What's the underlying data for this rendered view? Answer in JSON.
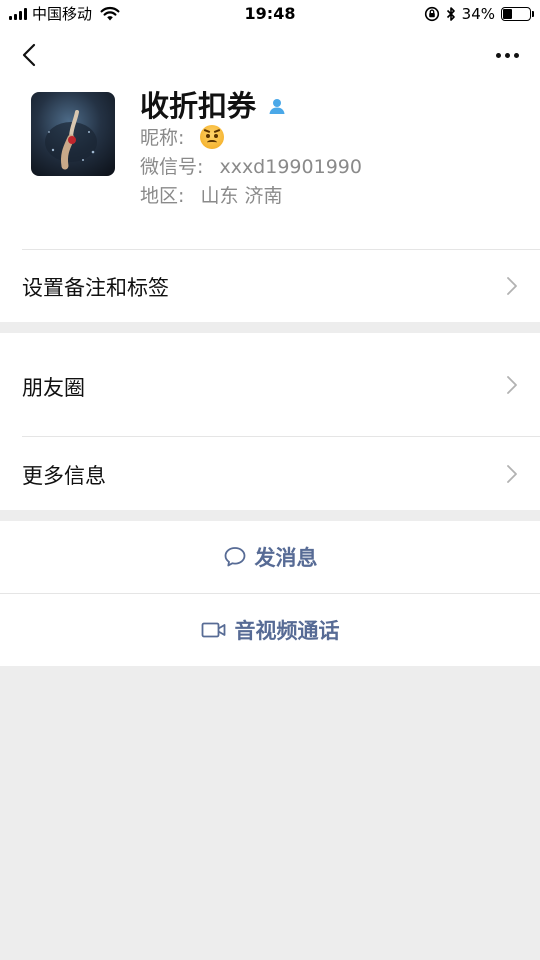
{
  "status_bar": {
    "carrier": "中国移动",
    "time": "19:48",
    "battery_percent": "34%",
    "battery_level": 0.34
  },
  "profile": {
    "name": "收折扣券",
    "nickname_label": "昵称:",
    "wechat_id_label": "微信号:",
    "wechat_id": "xxxd19901990",
    "region_label": "地区:",
    "region": "山东 济南"
  },
  "menu": {
    "remarks_tags": "设置备注和标签",
    "moments": "朋友圈",
    "more_info": "更多信息"
  },
  "actions": {
    "send_message": "发消息",
    "video_call": "音视频通话"
  },
  "colors": {
    "accent": "#576b95",
    "gender_icon": "#4aa8e8",
    "background": "#ededed"
  },
  "icons": {
    "back": "chevron-left-icon",
    "more": "more-dots-icon",
    "gender": "male-person-icon",
    "chevron": "chevron-right-icon",
    "message": "chat-bubble-icon",
    "video": "video-camera-icon"
  }
}
